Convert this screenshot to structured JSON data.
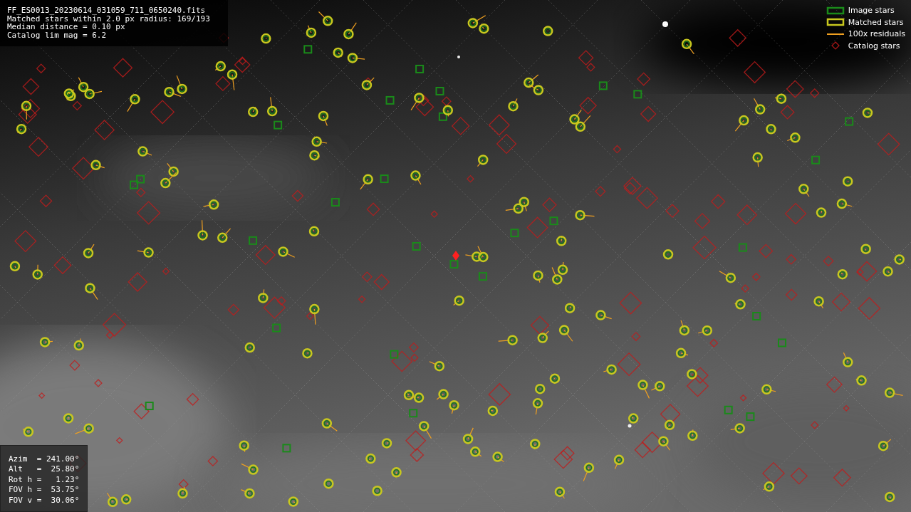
{
  "info_box": {
    "lines": [
      "FF_ES0013_20230614_031059_711_0650240.fits",
      "Matched stars within 2.0 px radius: 169/193",
      "Median distance = 0.10 px",
      "Catalog lim mag = 6.2"
    ]
  },
  "legend": [
    {
      "kind": "box",
      "label": "Image stars",
      "color": "#1a8a1a"
    },
    {
      "kind": "box",
      "label": "Matched stars",
      "color": "#c8c81e"
    },
    {
      "kind": "line",
      "label": "100x residuals",
      "color": "#f0a020"
    },
    {
      "kind": "diamond",
      "label": "Catalog stars",
      "color": "#b01818"
    }
  ],
  "pointing_box": {
    "lines": [
      "Azim  = 241.00°",
      "Alt   =  25.80°",
      "Rot h =   1.23°",
      "FOV h =  53.75°",
      "FOV v =  30.06°"
    ]
  }
}
